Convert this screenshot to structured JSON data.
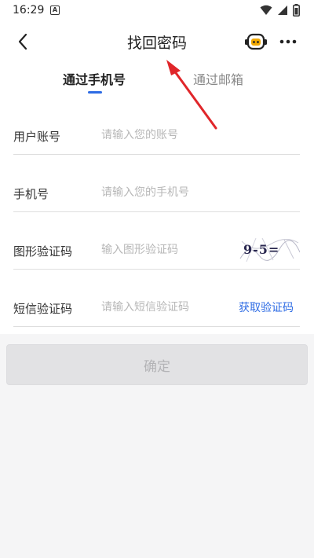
{
  "status_bar": {
    "time": "16:29",
    "a_badge": "A"
  },
  "nav": {
    "title": "找回密码"
  },
  "tabs": [
    {
      "label": "通过手机号",
      "active": true
    },
    {
      "label": "通过邮箱",
      "active": false
    }
  ],
  "form": {
    "account": {
      "label": "用户账号",
      "placeholder": "请输入您的账号"
    },
    "phone": {
      "label": "手机号",
      "placeholder": "请输入您的手机号"
    },
    "captcha": {
      "label": "图形验证码",
      "placeholder": "输入图形验证码",
      "captcha_text": "9-5="
    },
    "sms": {
      "label": "短信验证码",
      "placeholder": "请输入短信验证码",
      "get_code_label": "获取验证码"
    }
  },
  "confirm": {
    "label": "确定"
  },
  "colors": {
    "accent": "#2d6be4",
    "annotation": "#e0262a"
  }
}
